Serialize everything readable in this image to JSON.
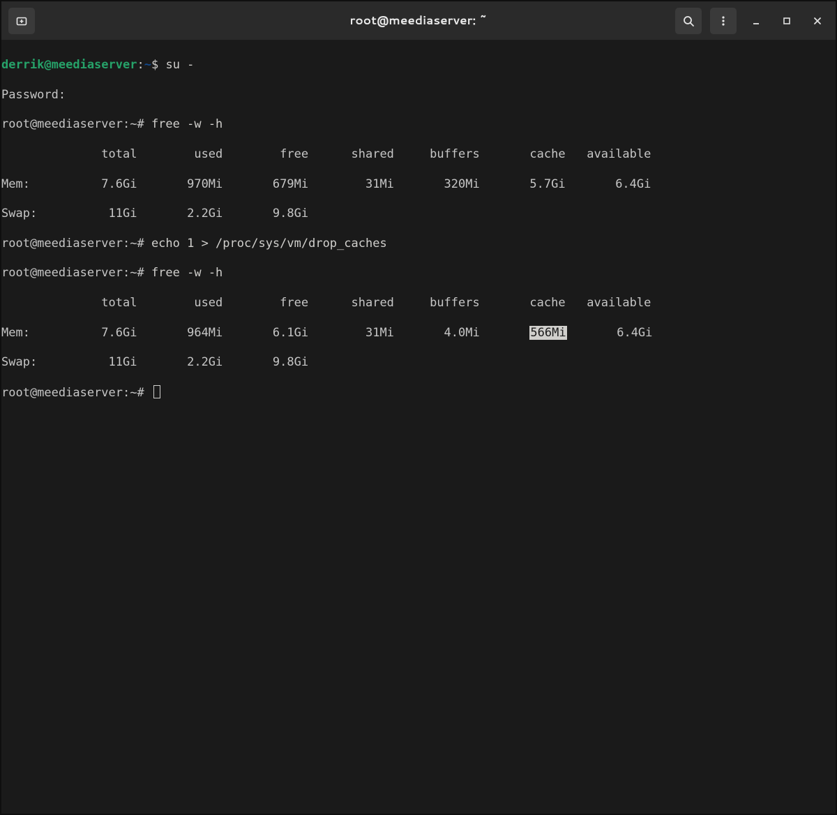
{
  "titlebar": {
    "title": "root@meediaserver: ~"
  },
  "prompts": {
    "user_prompt_user": "derrik@meediaserver",
    "user_prompt_sep": ":",
    "user_prompt_path": "~",
    "user_prompt_suffix": "$ ",
    "root_prompt": "root@meediaserver:~# "
  },
  "lines": {
    "l1_cmd": "su -",
    "l2": "Password:",
    "l3_cmd": "free -w -h",
    "headers": "              total        used        free      shared     buffers       cache   available",
    "l5": "Mem:          7.6Gi       970Mi       679Mi        31Mi       320Mi       5.7Gi       6.4Gi",
    "l6": "Swap:          11Gi       2.2Gi       9.8Gi",
    "l7_cmd": "echo 1 > /proc/sys/vm/drop_caches",
    "l8_cmd": "free -w -h",
    "l10a": "Mem:          7.6Gi       964Mi       6.1Gi        31Mi       4.0Mi       ",
    "l10_sel": "566Mi",
    "l10b": "       6.4Gi",
    "l11": "Swap:          11Gi       2.2Gi       9.8Gi"
  },
  "free_table_1": {
    "columns": [
      "total",
      "used",
      "free",
      "shared",
      "buffers",
      "cache",
      "available"
    ],
    "Mem": [
      "7.6Gi",
      "970Mi",
      "679Mi",
      "31Mi",
      "320Mi",
      "5.7Gi",
      "6.4Gi"
    ],
    "Swap": [
      "11Gi",
      "2.2Gi",
      "9.8Gi"
    ]
  },
  "free_table_2": {
    "columns": [
      "total",
      "used",
      "free",
      "shared",
      "buffers",
      "cache",
      "available"
    ],
    "Mem": [
      "7.6Gi",
      "964Mi",
      "6.1Gi",
      "31Mi",
      "4.0Mi",
      "566Mi",
      "6.4Gi"
    ],
    "Swap": [
      "11Gi",
      "2.2Gi",
      "9.8Gi"
    ]
  }
}
